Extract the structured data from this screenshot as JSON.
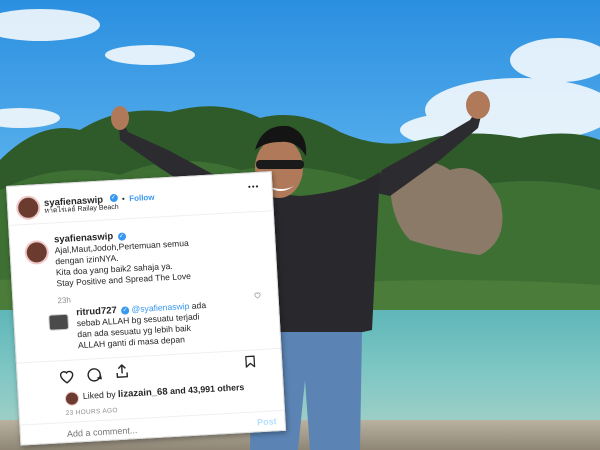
{
  "post_header": {
    "username": "syafienaswip",
    "follow_label": "Follow",
    "location": "หาดไร่เลย์ Railay Beach",
    "more_label": "•••"
  },
  "caption": {
    "username": "syafienaswip",
    "lines": [
      "Ajal,Maut,Jodoh,Pertemuan semua",
      "dengan izinNYA.",
      "Kita doa yang baik2 sahaja ya.",
      "Stay Positive and Spread The Love"
    ],
    "time": "23h"
  },
  "comment": {
    "username": "ritrud727",
    "mention": "@syafienaswip",
    "lines": [
      "ada",
      "sebab ALLAH bg sesuatu terjadi",
      "dan ada sesuatu yg lebih baik",
      "ALLAH ganti di masa depan"
    ]
  },
  "likes": {
    "prefix": "Liked by",
    "user": "lizazain_68",
    "suffix": "and 43,991 others"
  },
  "timestamp": "23 HOURS AGO",
  "add_comment_placeholder": "Add a comment...",
  "post_button": "Post",
  "icons": {
    "like": "heart-icon",
    "comment": "comment-icon",
    "share": "share-icon",
    "save": "bookmark-icon",
    "comment_like": "small-heart-icon",
    "verified": "verified-badge-icon"
  },
  "colors": {
    "link_blue": "#3897f0",
    "text": "#262626",
    "muted": "#8e8e8e"
  }
}
